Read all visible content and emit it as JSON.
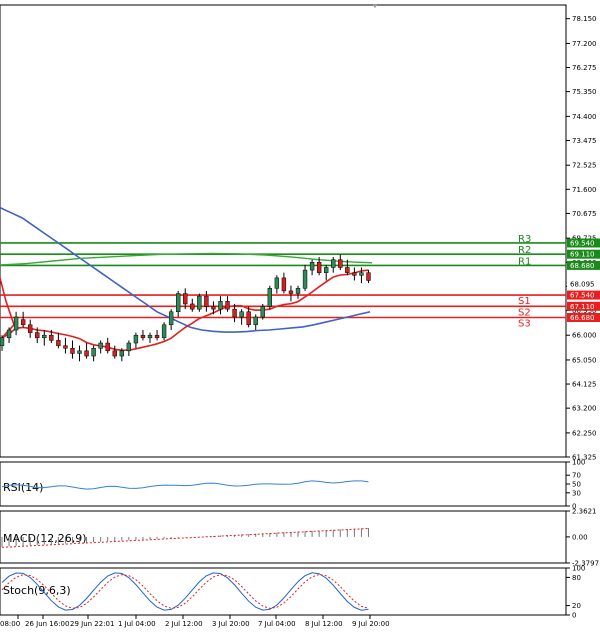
{
  "colors": {
    "up_candle": "#2e8b57",
    "down_candle": "#d42020",
    "resistance": "#1a8a1a",
    "support": "#e52020",
    "ma_slow": "#4062c4",
    "ma_mid": "#3aa83a",
    "ma_fast": "#e02020",
    "rsi": "#3a7de0",
    "stoch_main": "#1e62d0",
    "stoch_signal": "#e02020",
    "macd_hist": "#777777",
    "macd_signal": "#e02020",
    "current_price_tag": "#000000"
  },
  "price_axis": {
    "ticks": [
      "78.150",
      "77.200",
      "76.275",
      "75.350",
      "74.400",
      "73.475",
      "72.525",
      "71.600",
      "70.675",
      "69.725",
      "68.800",
      "67.875",
      "66.950",
      "66.000",
      "65.050",
      "64.125",
      "63.200",
      "62.250",
      "61.325"
    ],
    "current_price": "68.095"
  },
  "levels": [
    {
      "name": "R3",
      "value": "69.540",
      "kind": "resistance"
    },
    {
      "name": "R2",
      "value": "69.110",
      "kind": "resistance"
    },
    {
      "name": "R1",
      "value": "68.680",
      "kind": "resistance"
    },
    {
      "name": "S1",
      "value": "67.540",
      "kind": "support"
    },
    {
      "name": "S2",
      "value": "67.110",
      "kind": "support"
    },
    {
      "name": "S3",
      "value": "66.680",
      "kind": "support"
    }
  ],
  "indicators": {
    "rsi": {
      "label": "RSI(14)",
      "ticks": [
        "100",
        "70",
        "50",
        "30",
        "0"
      ]
    },
    "macd": {
      "label": "MACD(12,26,9)",
      "ticks": [
        "2.3621",
        "0.00",
        "-2.3797"
      ]
    },
    "stoch": {
      "label": "Stoch(9,6,3)",
      "ticks": [
        "100",
        "80",
        "20",
        "0"
      ]
    }
  },
  "time_axis": {
    "labels": [
      "08:00",
      "26 Jun 16:00",
      "29 Jun 22:01",
      "1 Jul 04:00",
      "2 Jul 12:00",
      "3 Jul 20:00",
      "7 Jul 04:00",
      "8 Jul 12:00",
      "9 Jul 20:00"
    ]
  },
  "chart_data": {
    "type": "candlestick",
    "ylim": [
      61.325,
      78.675
    ],
    "resistance": [
      69.54,
      69.11,
      68.68
    ],
    "support": [
      67.54,
      67.11,
      66.68
    ],
    "current_price": 68.095,
    "candles": [
      [
        65.6,
        66.0,
        65.4,
        65.9
      ],
      [
        65.9,
        66.3,
        65.7,
        66.2
      ],
      [
        66.2,
        66.9,
        66.0,
        66.7
      ],
      [
        66.6,
        66.9,
        66.3,
        66.4
      ],
      [
        66.4,
        66.6,
        65.9,
        66.1
      ],
      [
        66.1,
        66.3,
        65.7,
        65.9
      ],
      [
        65.9,
        66.2,
        65.6,
        66.0
      ],
      [
        66.0,
        66.2,
        65.7,
        65.8
      ],
      [
        65.8,
        66.1,
        65.5,
        65.6
      ],
      [
        65.6,
        65.9,
        65.3,
        65.5
      ],
      [
        65.5,
        65.8,
        65.1,
        65.3
      ],
      [
        65.3,
        65.6,
        65.0,
        65.4
      ],
      [
        65.4,
        65.7,
        65.1,
        65.2
      ],
      [
        65.2,
        65.6,
        65.0,
        65.5
      ],
      [
        65.5,
        65.8,
        65.3,
        65.7
      ],
      [
        65.7,
        65.9,
        65.3,
        65.4
      ],
      [
        65.4,
        65.6,
        65.1,
        65.2
      ],
      [
        65.2,
        65.5,
        65.0,
        65.4
      ],
      [
        65.4,
        65.8,
        65.2,
        65.7
      ],
      [
        65.7,
        66.1,
        65.5,
        66.0
      ],
      [
        66.0,
        66.2,
        65.8,
        65.9
      ],
      [
        65.9,
        66.1,
        65.7,
        66.0
      ],
      [
        66.0,
        66.2,
        65.8,
        65.9
      ],
      [
        65.9,
        66.5,
        65.8,
        66.4
      ],
      [
        66.4,
        67.0,
        66.2,
        66.9
      ],
      [
        66.9,
        67.7,
        66.7,
        67.6
      ],
      [
        67.6,
        67.8,
        67.0,
        67.2
      ],
      [
        67.2,
        67.4,
        66.9,
        67.0
      ],
      [
        67.0,
        67.6,
        66.9,
        67.5
      ],
      [
        67.5,
        67.7,
        66.9,
        67.1
      ],
      [
        67.1,
        67.3,
        66.8,
        67.0
      ],
      [
        67.0,
        67.5,
        66.8,
        67.3
      ],
      [
        67.3,
        67.5,
        66.9,
        67.0
      ],
      [
        67.0,
        67.2,
        66.5,
        66.7
      ],
      [
        66.7,
        67.0,
        66.4,
        66.9
      ],
      [
        66.9,
        67.1,
        66.3,
        66.4
      ],
      [
        66.4,
        66.8,
        66.2,
        66.7
      ],
      [
        66.7,
        67.2,
        66.6,
        67.1
      ],
      [
        67.1,
        67.9,
        67.0,
        67.8
      ],
      [
        67.8,
        68.3,
        67.6,
        68.2
      ],
      [
        68.2,
        68.4,
        67.6,
        67.7
      ],
      [
        67.7,
        67.9,
        67.3,
        67.6
      ],
      [
        67.6,
        67.9,
        67.4,
        67.8
      ],
      [
        67.8,
        68.7,
        67.7,
        68.5
      ],
      [
        68.5,
        68.9,
        68.3,
        68.8
      ],
      [
        68.8,
        69.0,
        68.3,
        68.4
      ],
      [
        68.4,
        68.7,
        68.1,
        68.6
      ],
      [
        68.6,
        69.0,
        68.4,
        68.9
      ],
      [
        68.9,
        69.1,
        68.5,
        68.6
      ],
      [
        68.6,
        68.9,
        68.3,
        68.4
      ],
      [
        68.4,
        68.6,
        68.1,
        68.3
      ],
      [
        68.3,
        68.6,
        68.0,
        68.4
      ],
      [
        68.4,
        68.5,
        68.0,
        68.1
      ]
    ]
  }
}
